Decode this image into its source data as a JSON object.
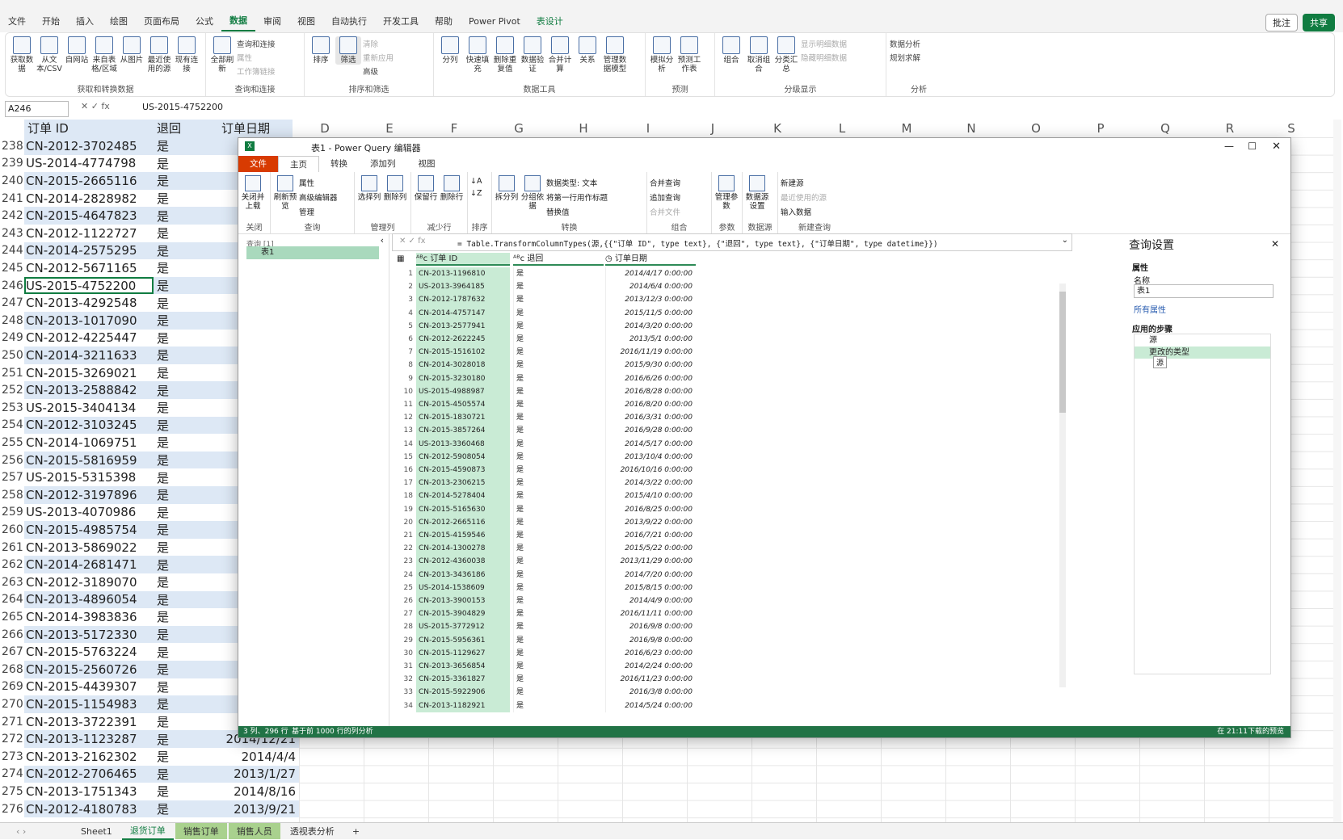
{
  "excel": {
    "tabs": [
      "文件",
      "开始",
      "插入",
      "绘图",
      "页面布局",
      "公式",
      "数据",
      "审阅",
      "视图",
      "自动执行",
      "开发工具",
      "帮助",
      "Power Pivot",
      "表设计"
    ],
    "active_tab": "数据",
    "right_buttons": {
      "comment": "批注",
      "share": "共享"
    },
    "ribbon_groups": [
      {
        "label": "获取和转换数据",
        "buttons": [
          "获取数据",
          "从文本/CSV",
          "自网站",
          "来自表格/区域",
          "从图片",
          "最近使用的源",
          "现有连接"
        ]
      },
      {
        "label": "查询和连接",
        "buttons": [
          "全部刷新"
        ],
        "small": [
          "查询和连接",
          "属性",
          "工作簿链接"
        ]
      },
      {
        "label": "排序和筛选",
        "buttons": [
          "排序",
          "筛选"
        ],
        "small": [
          "清除",
          "重新应用",
          "高级"
        ]
      },
      {
        "label": "数据工具",
        "buttons": [
          "分列",
          "快速填充",
          "删除重复值",
          "数据验证",
          "合并计算",
          "关系",
          "管理数据模型"
        ]
      },
      {
        "label": "预测",
        "buttons": [
          "模拟分析",
          "预测工作表"
        ]
      },
      {
        "label": "分级显示",
        "buttons": [
          "组合",
          "取消组合",
          "分类汇总"
        ],
        "small": [
          "显示明细数据",
          "隐藏明细数据"
        ]
      },
      {
        "label": "分析",
        "small": [
          "数据分析",
          "规划求解"
        ]
      }
    ],
    "namebox": "A246",
    "formula": "US-2015-4752200",
    "columns": [
      "D",
      "E",
      "F",
      "G",
      "H",
      "I",
      "J",
      "K",
      "L",
      "M",
      "N",
      "O",
      "P",
      "Q",
      "R",
      "S"
    ],
    "headers": [
      "订单 ID",
      "退回",
      "订单日期"
    ],
    "rows": [
      {
        "n": "238",
        "id": "CN-2012-3702485",
        "r": "是",
        "d": ""
      },
      {
        "n": "239",
        "id": "US-2014-4774798",
        "r": "是",
        "d": ""
      },
      {
        "n": "240",
        "id": "CN-2015-2665116",
        "r": "是",
        "d": ""
      },
      {
        "n": "241",
        "id": "CN-2014-2828982",
        "r": "是",
        "d": ""
      },
      {
        "n": "242",
        "id": "CN-2015-4647823",
        "r": "是",
        "d": ""
      },
      {
        "n": "243",
        "id": "CN-2012-1122727",
        "r": "是",
        "d": ""
      },
      {
        "n": "244",
        "id": "CN-2014-2575295",
        "r": "是",
        "d": ""
      },
      {
        "n": "245",
        "id": "CN-2012-5671165",
        "r": "是",
        "d": ""
      },
      {
        "n": "246",
        "id": "US-2015-4752200",
        "r": "是",
        "d": ""
      },
      {
        "n": "247",
        "id": "CN-2013-4292548",
        "r": "是",
        "d": ""
      },
      {
        "n": "248",
        "id": "CN-2013-1017090",
        "r": "是",
        "d": "2"
      },
      {
        "n": "249",
        "id": "CN-2012-4225447",
        "r": "是",
        "d": "2"
      },
      {
        "n": "250",
        "id": "CN-2014-3211633",
        "r": "是",
        "d": "2"
      },
      {
        "n": "251",
        "id": "CN-2015-3269021",
        "r": "是",
        "d": ""
      },
      {
        "n": "252",
        "id": "CN-2013-2588842",
        "r": "是",
        "d": ""
      },
      {
        "n": "253",
        "id": "US-2015-3404134",
        "r": "是",
        "d": ""
      },
      {
        "n": "254",
        "id": "CN-2012-3103245",
        "r": "是",
        "d": ""
      },
      {
        "n": "255",
        "id": "CN-2014-1069751",
        "r": "是",
        "d": ""
      },
      {
        "n": "256",
        "id": "CN-2015-5816959",
        "r": "是",
        "d": ""
      },
      {
        "n": "257",
        "id": "US-2015-5315398",
        "r": "是",
        "d": "2"
      },
      {
        "n": "258",
        "id": "CN-2012-3197896",
        "r": "是",
        "d": "2"
      },
      {
        "n": "259",
        "id": "US-2013-4070986",
        "r": "是",
        "d": ""
      },
      {
        "n": "260",
        "id": "CN-2015-4985754",
        "r": "是",
        "d": ""
      },
      {
        "n": "261",
        "id": "CN-2013-5869022",
        "r": "是",
        "d": ""
      },
      {
        "n": "262",
        "id": "CN-2014-2681471",
        "r": "是",
        "d": "2"
      },
      {
        "n": "263",
        "id": "CN-2012-3189070",
        "r": "是",
        "d": ""
      },
      {
        "n": "264",
        "id": "CN-2013-4896054",
        "r": "是",
        "d": ""
      },
      {
        "n": "265",
        "id": "CN-2014-3983836",
        "r": "是",
        "d": ""
      },
      {
        "n": "266",
        "id": "CN-2013-5172330",
        "r": "是",
        "d": ""
      },
      {
        "n": "267",
        "id": "CN-2015-5763224",
        "r": "是",
        "d": "2"
      },
      {
        "n": "268",
        "id": "CN-2015-2560726",
        "r": "是",
        "d": "2"
      },
      {
        "n": "269",
        "id": "CN-2015-4439307",
        "r": "是",
        "d": ""
      },
      {
        "n": "270",
        "id": "CN-2015-1154983",
        "r": "是",
        "d": ""
      },
      {
        "n": "271",
        "id": "CN-2013-3722391",
        "r": "是",
        "d": ""
      },
      {
        "n": "272",
        "id": "CN-2013-1123287",
        "r": "是",
        "d": "2014/12/21"
      },
      {
        "n": "273",
        "id": "CN-2013-2162302",
        "r": "是",
        "d": "2014/4/4"
      },
      {
        "n": "274",
        "id": "CN-2012-2706465",
        "r": "是",
        "d": "2013/1/27"
      },
      {
        "n": "275",
        "id": "CN-2013-1751343",
        "r": "是",
        "d": "2014/8/16"
      },
      {
        "n": "276",
        "id": "CN-2012-4180783",
        "r": "是",
        "d": "2013/9/21"
      }
    ],
    "sheets": [
      "Sheet1",
      "退货订单",
      "销售订单",
      "销售人员",
      "透视表分析"
    ],
    "active_sheet": "退货订单"
  },
  "pq": {
    "title": "表1 - Power Query 编辑器",
    "tabs": [
      "文件",
      "主页",
      "转换",
      "添加列",
      "视图"
    ],
    "active_tab": "主页",
    "ribbon": [
      {
        "label": "关闭",
        "buttons": [
          "关闭并上载"
        ]
      },
      {
        "label": "查询",
        "buttons": [
          "刷新预览"
        ],
        "small": [
          "属性",
          "高级编辑器",
          "管理"
        ]
      },
      {
        "label": "管理列",
        "buttons": [
          "选择列",
          "删除列"
        ]
      },
      {
        "label": "减少行",
        "buttons": [
          "保留行",
          "删除行"
        ]
      },
      {
        "label": "排序",
        "buttons": []
      },
      {
        "label": "转换",
        "buttons": [
          "拆分列",
          "分组依据"
        ],
        "small": [
          "数据类型: 文本",
          "将第一行用作标题",
          "替换值"
        ]
      },
      {
        "label": "组合",
        "small": [
          "合并查询",
          "追加查询",
          "合并文件"
        ]
      },
      {
        "label": "参数",
        "buttons": [
          "管理参数"
        ]
      },
      {
        "label": "数据源",
        "buttons": [
          "数据源设置"
        ]
      },
      {
        "label": "新建查询",
        "small": [
          "新建源",
          "最近使用的源",
          "输入数据"
        ]
      }
    ],
    "nav_header": "查询 [1]",
    "nav_item": "表1",
    "formula": "= Table.TransformColumnTypes(源,{{\"订单 ID\", type text}, {\"退回\", type text}, {\"订单日期\", type datetime}})",
    "col_headers": [
      "订单 ID",
      "退回",
      "订单日期"
    ],
    "rows": [
      [
        "1",
        "CN-2013-1196810",
        "是",
        "2014/4/17 0:00:00"
      ],
      [
        "2",
        "US-2013-3964185",
        "是",
        "2014/6/4 0:00:00"
      ],
      [
        "3",
        "CN-2012-1787632",
        "是",
        "2013/12/3 0:00:00"
      ],
      [
        "4",
        "CN-2014-4757147",
        "是",
        "2015/11/5 0:00:00"
      ],
      [
        "5",
        "CN-2013-2577941",
        "是",
        "2014/3/20 0:00:00"
      ],
      [
        "6",
        "CN-2012-2622245",
        "是",
        "2013/5/1 0:00:00"
      ],
      [
        "7",
        "CN-2015-1516102",
        "是",
        "2016/11/19 0:00:00"
      ],
      [
        "8",
        "CN-2014-3028018",
        "是",
        "2015/9/30 0:00:00"
      ],
      [
        "9",
        "CN-2015-3230180",
        "是",
        "2016/6/26 0:00:00"
      ],
      [
        "10",
        "US-2015-4988987",
        "是",
        "2016/8/28 0:00:00"
      ],
      [
        "11",
        "CN-2015-4505574",
        "是",
        "2016/8/20 0:00:00"
      ],
      [
        "12",
        "CN-2015-1830721",
        "是",
        "2016/3/31 0:00:00"
      ],
      [
        "13",
        "CN-2015-3857264",
        "是",
        "2016/9/28 0:00:00"
      ],
      [
        "14",
        "US-2013-3360468",
        "是",
        "2014/5/17 0:00:00"
      ],
      [
        "15",
        "CN-2012-5908054",
        "是",
        "2013/10/4 0:00:00"
      ],
      [
        "16",
        "CN-2015-4590873",
        "是",
        "2016/10/16 0:00:00"
      ],
      [
        "17",
        "CN-2013-2306215",
        "是",
        "2014/3/22 0:00:00"
      ],
      [
        "18",
        "CN-2014-5278404",
        "是",
        "2015/4/10 0:00:00"
      ],
      [
        "19",
        "CN-2015-5165630",
        "是",
        "2016/8/25 0:00:00"
      ],
      [
        "20",
        "CN-2012-2665116",
        "是",
        "2013/9/22 0:00:00"
      ],
      [
        "21",
        "CN-2015-4159546",
        "是",
        "2016/7/21 0:00:00"
      ],
      [
        "22",
        "CN-2014-1300278",
        "是",
        "2015/5/22 0:00:00"
      ],
      [
        "23",
        "CN-2012-4360038",
        "是",
        "2013/11/29 0:00:00"
      ],
      [
        "24",
        "CN-2013-3436186",
        "是",
        "2014/7/20 0:00:00"
      ],
      [
        "25",
        "US-2014-1538609",
        "是",
        "2015/8/15 0:00:00"
      ],
      [
        "26",
        "CN-2013-3900153",
        "是",
        "2014/4/9 0:00:00"
      ],
      [
        "27",
        "CN-2015-3904829",
        "是",
        "2016/11/11 0:00:00"
      ],
      [
        "28",
        "US-2015-3772912",
        "是",
        "2016/9/8 0:00:00"
      ],
      [
        "29",
        "CN-2015-5956361",
        "是",
        "2016/9/8 0:00:00"
      ],
      [
        "30",
        "CN-2015-1129627",
        "是",
        "2016/6/23 0:00:00"
      ],
      [
        "31",
        "CN-2013-3656854",
        "是",
        "2014/2/24 0:00:00"
      ],
      [
        "32",
        "CN-2015-3361827",
        "是",
        "2016/11/23 0:00:00"
      ],
      [
        "33",
        "CN-2015-5922906",
        "是",
        "2016/3/8 0:00:00"
      ],
      [
        "34",
        "CN-2013-1182921",
        "是",
        "2014/5/24 0:00:00"
      ]
    ],
    "settings": {
      "title": "查询设置",
      "props_header": "属性",
      "name_label": "名称",
      "name_value": "表1",
      "all_props": "所有属性",
      "steps_header": "应用的步骤",
      "steps": [
        "源",
        "更改的类型"
      ],
      "tooltip": "源"
    },
    "status_left": "3 列、296 行",
    "status_mid": "基于前 1000 行的列分析",
    "status_right": "在 21:11下载的预览"
  }
}
